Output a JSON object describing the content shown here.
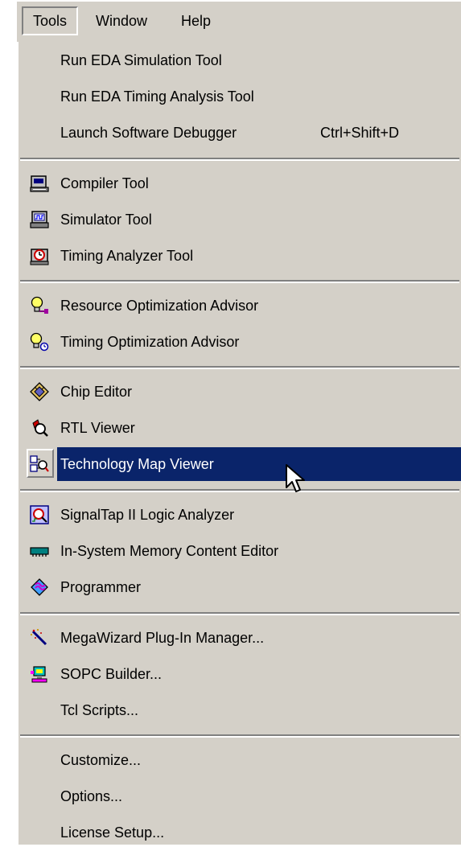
{
  "menubar": {
    "items": [
      {
        "label": "Tools"
      },
      {
        "label": "Window"
      },
      {
        "label": "Help"
      }
    ]
  },
  "menu": {
    "groups": [
      [
        {
          "label": "Run EDA Simulation Tool"
        },
        {
          "label": "Run EDA Timing Analysis Tool"
        },
        {
          "label": "Launch Software Debugger",
          "shortcut": "Ctrl+Shift+D"
        }
      ],
      [
        {
          "label": "Compiler Tool",
          "icon": "compiler-tool-icon"
        },
        {
          "label": "Simulator Tool",
          "icon": "simulator-tool-icon"
        },
        {
          "label": "Timing Analyzer Tool",
          "icon": "timing-analyzer-icon"
        }
      ],
      [
        {
          "label": "Resource Optimization Advisor",
          "icon": "resource-advisor-icon"
        },
        {
          "label": "Timing Optimization Advisor",
          "icon": "timing-advisor-icon"
        }
      ],
      [
        {
          "label": "Chip Editor",
          "icon": "chip-editor-icon"
        },
        {
          "label": "RTL Viewer",
          "icon": "rtl-viewer-icon"
        },
        {
          "label": "Technology Map Viewer",
          "icon": "technology-map-viewer-icon",
          "highlighted": true
        }
      ],
      [
        {
          "label": "SignalTap II Logic Analyzer",
          "icon": "signaltap-icon"
        },
        {
          "label": "In-System Memory Content Editor",
          "icon": "memory-editor-icon"
        },
        {
          "label": "Programmer",
          "icon": "programmer-icon"
        }
      ],
      [
        {
          "label": "MegaWizard Plug-In Manager...",
          "icon": "megawizard-icon"
        },
        {
          "label": "SOPC Builder...",
          "icon": "sopc-builder-icon"
        },
        {
          "label": "Tcl Scripts..."
        }
      ],
      [
        {
          "label": "Customize..."
        },
        {
          "label": "Options..."
        },
        {
          "label": "License Setup..."
        }
      ]
    ]
  },
  "colors": {
    "menu_bg": "#d4d0c8",
    "highlight_bg": "#0a246a",
    "highlight_text": "#ffffff"
  }
}
